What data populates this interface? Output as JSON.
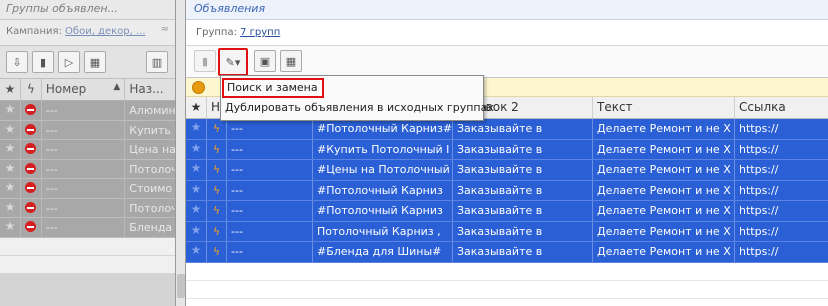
{
  "left_panel": {
    "title": "Группы объявлен...",
    "campaign_label": "Кампания:",
    "campaign_value": "Обои, декор, ...",
    "collapse_glyph": "≈",
    "columns": {
      "number": "Номер",
      "name": "Наз..."
    },
    "sort_glyph": "▲",
    "rows": [
      {
        "number": "---",
        "name": "Алюмин"
      },
      {
        "number": "---",
        "name": "Купить I"
      },
      {
        "number": "---",
        "name": "Цена на"
      },
      {
        "number": "---",
        "name": "Потолоч"
      },
      {
        "number": "---",
        "name": "Стоимо"
      },
      {
        "number": "---",
        "name": "Потолоч"
      },
      {
        "number": "---",
        "name": "Бленда ,"
      }
    ]
  },
  "right_panel": {
    "title": "Объявления",
    "group_label": "Группа:",
    "group_value": "7 групп",
    "columns": {
      "number": "Н",
      "title2": "головок 2",
      "text": "Текст",
      "link": "Ссылка"
    },
    "rows": [
      {
        "number": "---",
        "title": "#Потолочный Карниз#",
        "title2": "Заказывайте в",
        "text": "Делаете Ремонт и не Х",
        "link": "https://"
      },
      {
        "number": "---",
        "title": "#Купить Потолочный I",
        "title2": "Заказывайте в",
        "text": "Делаете Ремонт и не Х",
        "link": "https://"
      },
      {
        "number": "---",
        "title": "#Цены на Потолочный",
        "title2": "Заказывайте в",
        "text": "Делаете Ремонт и не Х",
        "link": "https://"
      },
      {
        "number": "---",
        "title": "#Потолочный Карниз",
        "title2": "Заказывайте в",
        "text": "Делаете Ремонт и не Х",
        "link": "https://"
      },
      {
        "number": "---",
        "title": "#Потолочный Карниз",
        "title2": "Заказывайте в",
        "text": "Делаете Ремонт и не Х",
        "link": "https://"
      },
      {
        "number": "---",
        "title": "Потолочный Карниз ,",
        "title2": "Заказывайте в",
        "text": "Делаете Ремонт и не Х",
        "link": "https://"
      },
      {
        "number": "---",
        "title": "#Бленда для Шины#",
        "title2": "Заказывайте в",
        "text": "Делаете Ремонт и не Х",
        "link": "https://"
      }
    ]
  },
  "dropdown_menu": {
    "items": [
      "Поиск и замена",
      "Дублировать объявления в исходных группах"
    ]
  },
  "icons": {
    "star": "star-icon",
    "bolt": "bolt-icon",
    "status": "stop-icon",
    "info": "info-icon"
  },
  "colors": {
    "selected_row": "#2a5fd6",
    "highlight": "#e01010",
    "disabled_row": "#a8a8a8"
  }
}
